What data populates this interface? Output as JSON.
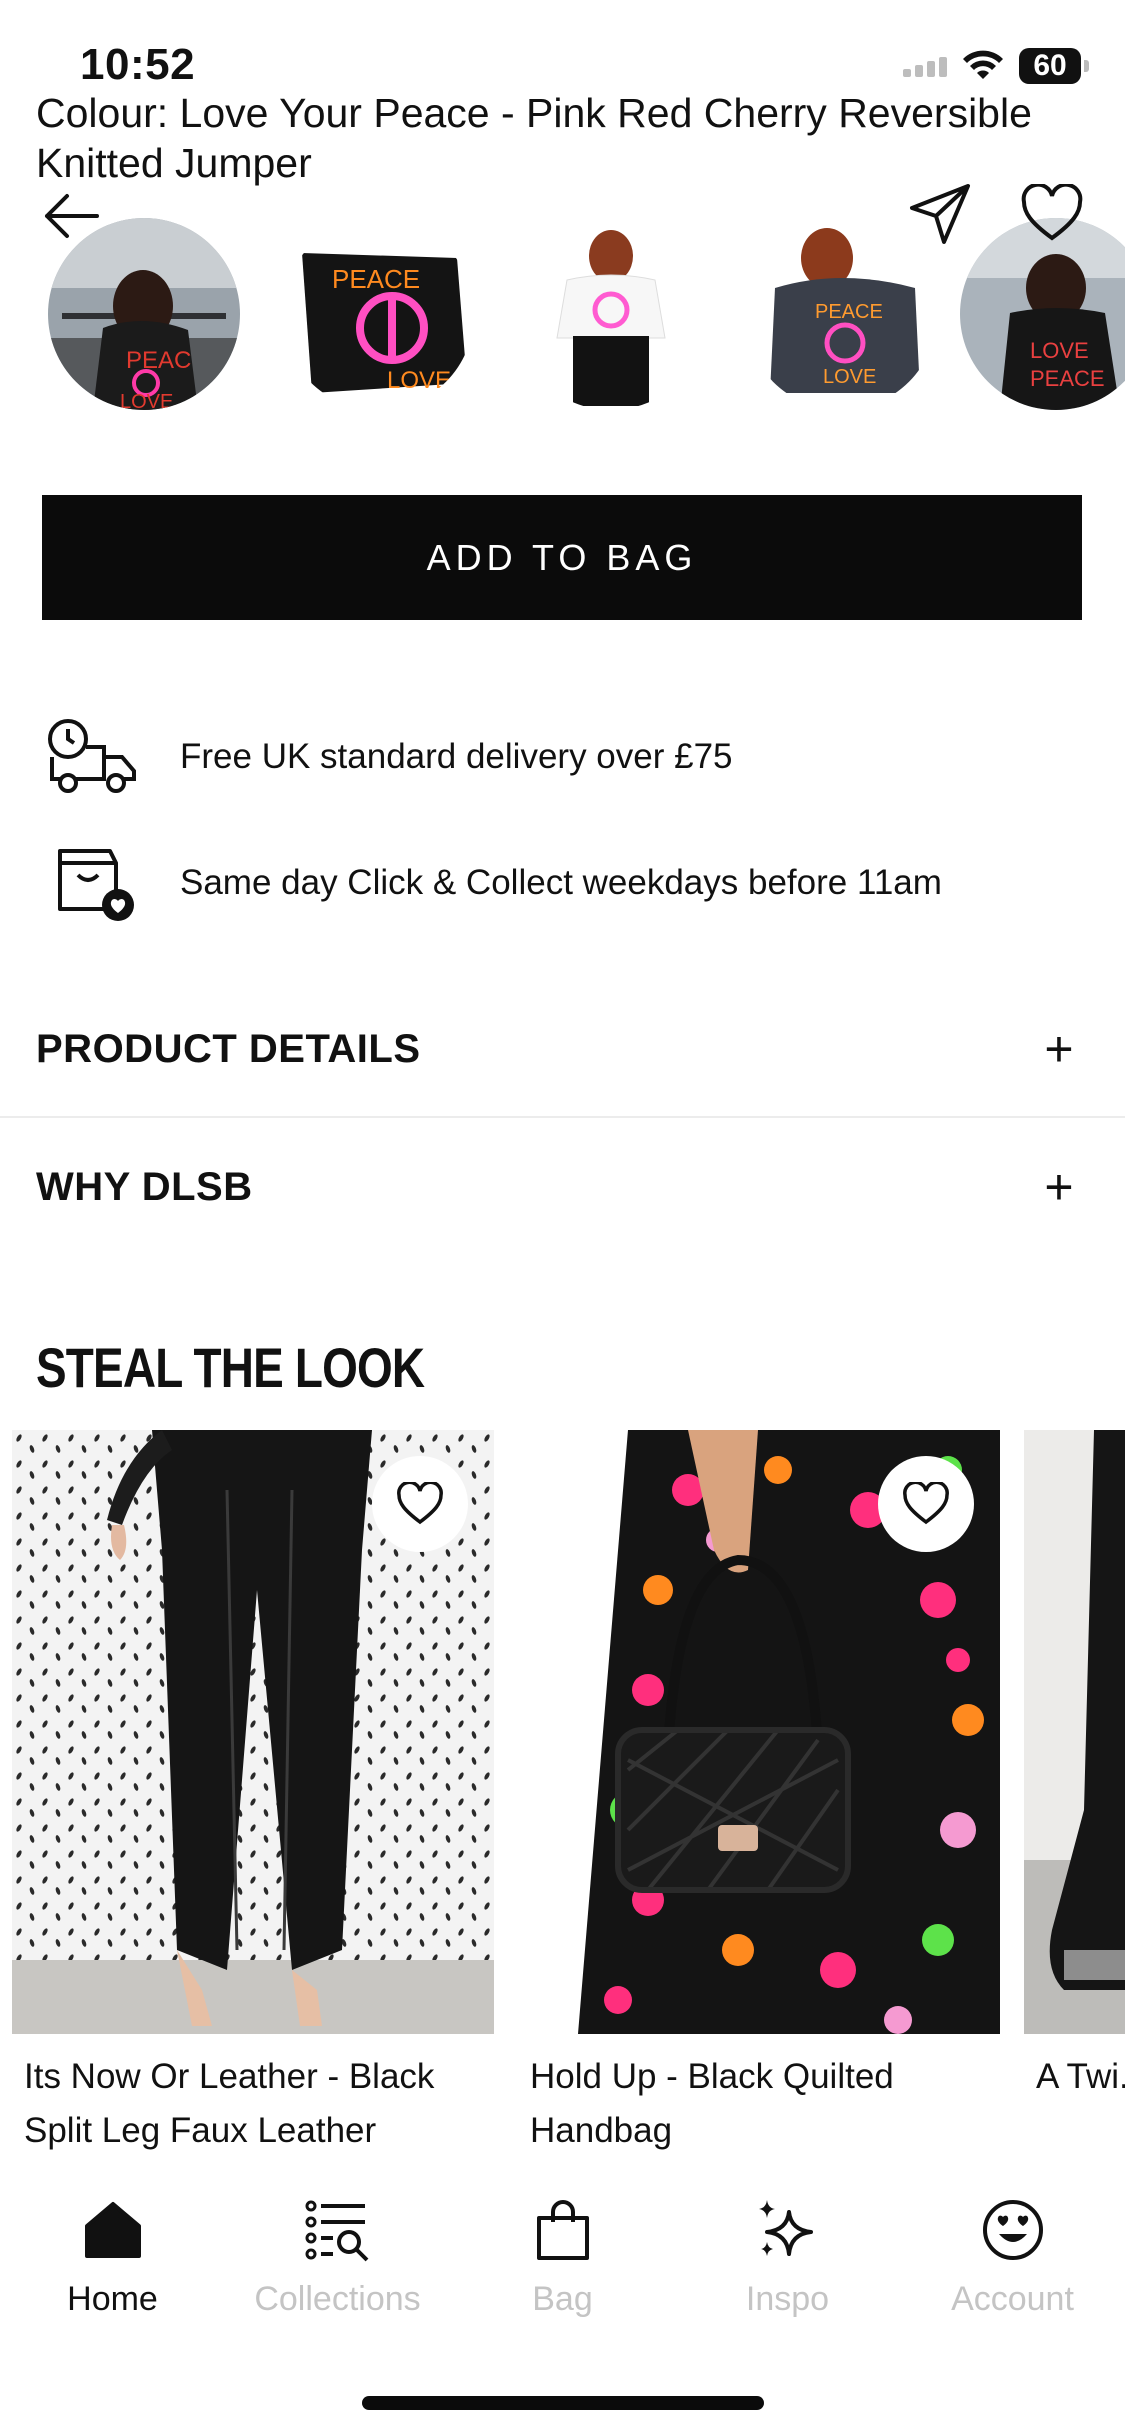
{
  "status": {
    "time": "10:52",
    "battery": "60"
  },
  "product": {
    "colour_title": "Colour: Love Your Peace - Pink Red Cherry Reversible Knitted Jumper",
    "add_to_bag": "ADD TO BAG"
  },
  "thumbnails": [
    "thumbnail-1",
    "thumbnail-2",
    "thumbnail-3",
    "thumbnail-4",
    "thumbnail-5"
  ],
  "info": {
    "delivery": "Free UK standard delivery over £75",
    "collect": "Same day Click & Collect weekdays before 11am"
  },
  "accordions": {
    "product_details": "PRODUCT DETAILS",
    "why_dlsb": "WHY DLSB",
    "plus": "+"
  },
  "steal_the_look": {
    "title": "STEAL THE LOOK",
    "items": [
      {
        "name": "Its Now Or Leather - Black Split Leg Faux Leather"
      },
      {
        "name": "Hold Up - Black Quilted Handbag"
      },
      {
        "name": "A Twi... Black..."
      }
    ]
  },
  "nav": [
    {
      "label": "Home",
      "icon": "home-icon",
      "active": true
    },
    {
      "label": "Collections",
      "icon": "collections-icon",
      "active": false
    },
    {
      "label": "Bag",
      "icon": "bag-icon",
      "active": false
    },
    {
      "label": "Inspo",
      "icon": "sparkle-icon",
      "active": false
    },
    {
      "label": "Account",
      "icon": "smiley-icon",
      "active": false
    }
  ]
}
